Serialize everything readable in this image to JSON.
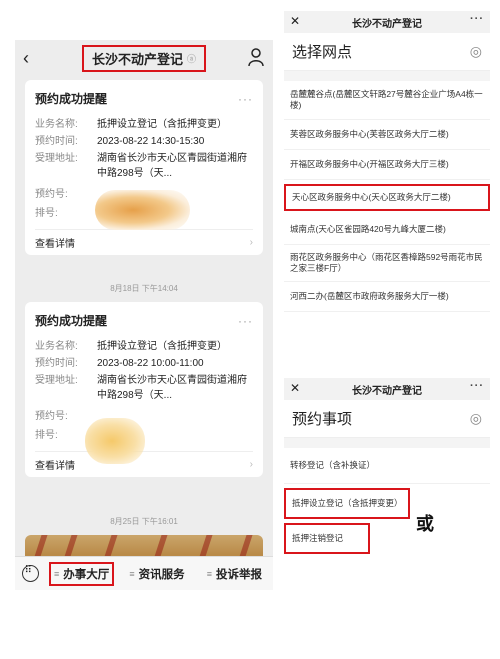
{
  "left": {
    "nav_title": "长沙不动产登记",
    "nav_icon_text": "ⓐ",
    "cards": [
      {
        "title": "预约成功提醒",
        "more": "···",
        "rows": [
          {
            "k": "业务名称:",
            "v": "抵押设立登记（含抵押变更）"
          },
          {
            "k": "预约时间:",
            "v": "2023-08-22 14:30-15:30"
          },
          {
            "k": "受理地址:",
            "v": "湖南省长沙市天心区青园街道湘府中路298号（天..."
          },
          {
            "k": "预约号:",
            "v": ""
          },
          {
            "k": "排号:",
            "v": ""
          }
        ],
        "detail": "查看详情",
        "arrow": "›"
      },
      {
        "title": "预约成功提醒",
        "more": "···",
        "rows": [
          {
            "k": "业务名称:",
            "v": "抵押设立登记（含抵押变更）"
          },
          {
            "k": "预约时间:",
            "v": "2023-08-22 10:00-11:00"
          },
          {
            "k": "受理地址:",
            "v": "湖南省长沙市天心区青园街道湘府中路298号（天..."
          },
          {
            "k": "预约号:",
            "v": ""
          },
          {
            "k": "排号:",
            "v": ""
          }
        ],
        "detail": "查看详情",
        "arrow": "›"
      }
    ],
    "timestamps": [
      "8月18日 下午14:04",
      "8月25日 下午16:01"
    ],
    "bottom_tabs": [
      {
        "label": "办事大厅",
        "icon": "≡"
      },
      {
        "label": "资讯服务",
        "icon": "≡"
      },
      {
        "label": "投诉举报",
        "icon": "≡"
      }
    ]
  },
  "panel_top": {
    "header_title": "长沙不动产登记",
    "close": "✕",
    "more": "···",
    "title": "选择网点",
    "title_icon": "◎",
    "options": [
      "岳麓麓谷点(岳麓区文轩路27号麓谷企业广场A4栋一楼)",
      "芙蓉区政务服务中心(芙蓉区政务大厅二楼)",
      "开福区政务服务中心(开福区政务大厅三楼)",
      "天心区政务服务中心(天心区政务大厅二楼)",
      "城南点(天心区雀园路420号九峰大厦二楼)",
      "雨花区政务服务中心（雨花区香樟路592号雨花市民之家三楼F厅）",
      "河西二办(岳麓区市政府政务服务大厅一楼)"
    ],
    "highlighted_index": 3
  },
  "panel_bottom": {
    "header_title": "长沙不动产登记",
    "close": "✕",
    "more": "···",
    "title": "预约事项",
    "title_icon": "◎",
    "options": [
      "转移登记（含补换证）",
      "抵押设立登记（含抵押变更）",
      "抵押注销登记"
    ],
    "highlighted_indices": [
      1,
      2
    ]
  },
  "or_label": "或",
  "colors": {
    "highlight": "#d9151b",
    "chat_bg": "#ededed"
  }
}
